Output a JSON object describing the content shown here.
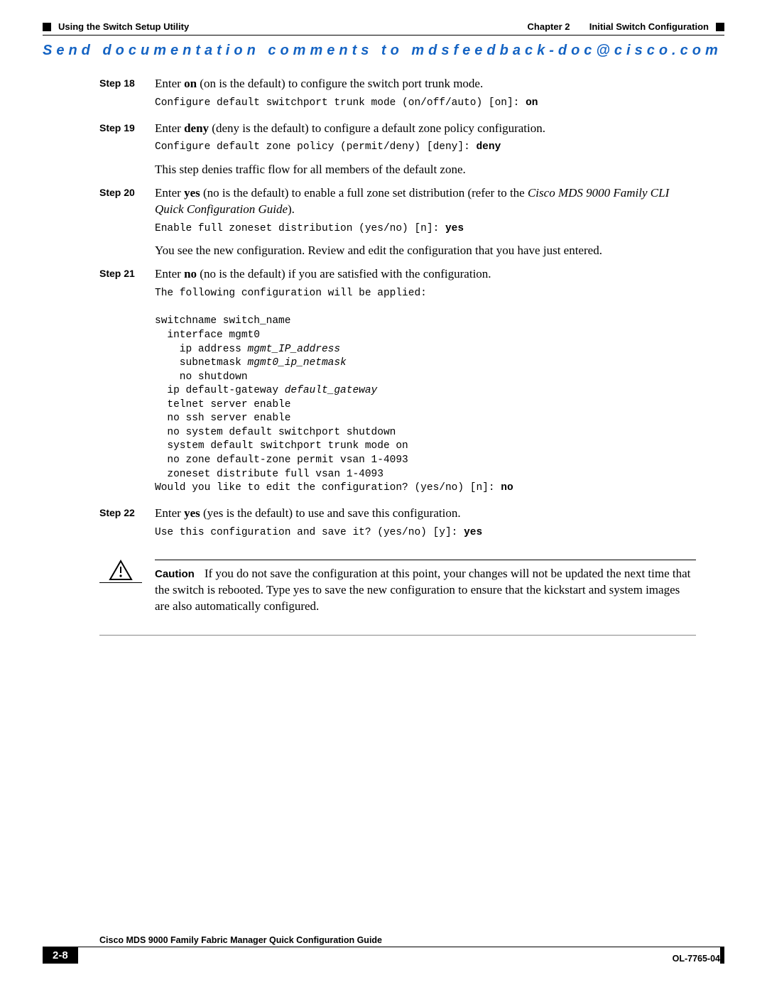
{
  "header": {
    "left": "Using the Switch Setup Utility",
    "chapter": "Chapter 2",
    "title": "Initial Switch Configuration"
  },
  "banner": "Send documentation comments to mdsfeedback-doc@cisco.com",
  "steps": {
    "s18": {
      "label": "Step 18",
      "text_pre": "Enter ",
      "text_bold": "on",
      "text_post": " (on is the default) to configure the switch port trunk mode.",
      "code": "Configure default switchport trunk mode (on/off/auto) [on]: ",
      "code_bold": "on"
    },
    "s19": {
      "label": "Step 19",
      "text_pre": "Enter ",
      "text_bold": "deny",
      "text_post": " (deny is the default) to configure a default zone policy configuration.",
      "code": "Configure default zone policy (permit/deny) [deny]: ",
      "code_bold": "deny",
      "after": "This step denies traffic flow for all members of the default zone."
    },
    "s20": {
      "label": "Step 20",
      "text_pre": "Enter ",
      "text_bold": "yes",
      "text_post1": " (no is the default) to enable a full zone set distribution (refer to the ",
      "text_ital": "Cisco MDS 9000 Family CLI Quick Configuration Guide",
      "text_post2": ").",
      "code": "Enable full zoneset distribution (yes/no) [n]: ",
      "code_bold": "yes",
      "after": "You see the new configuration. Review and edit the configuration that you have just entered."
    },
    "s21": {
      "label": "Step 21",
      "text_pre": "Enter ",
      "text_bold": "no",
      "text_post": " (no is the default) if you are satisfied with the configuration.",
      "code_lines": [
        {
          "t": "The following configuration will be applied:"
        },
        {
          "t": ""
        },
        {
          "t": "switchname switch_name"
        },
        {
          "t": "  interface mgmt0"
        },
        {
          "t": "    ip address ",
          "i": "mgmt_IP_address"
        },
        {
          "t": "    subnetmask ",
          "i": "mgmt0_ip_netmask"
        },
        {
          "t": "    no shutdown"
        },
        {
          "t": "  ip default-gateway ",
          "i": "default_gateway"
        },
        {
          "t": "  telnet server enable"
        },
        {
          "t": "  no ssh server enable"
        },
        {
          "t": "  no system default switchport shutdown"
        },
        {
          "t": "  system default switchport trunk mode on"
        },
        {
          "t": "  no zone default-zone permit vsan 1-4093"
        },
        {
          "t": "  zoneset distribute full vsan 1-4093"
        },
        {
          "t": "Would you like to edit the configuration? (yes/no) [n]: ",
          "b": "no"
        }
      ]
    },
    "s22": {
      "label": "Step 22",
      "text_pre": "Enter ",
      "text_bold": "yes",
      "text_post": " (yes is the default) to use and save this configuration.",
      "code": "Use this configuration and save it? (yes/no) [y]: ",
      "code_bold": "yes"
    }
  },
  "caution": {
    "label": "Caution",
    "text": "If you do not save the configuration at this point, your changes will not be updated the next time that the switch is rebooted. Type yes to save the new configuration to ensure that the kickstart and system images are also automatically configured."
  },
  "footer": {
    "title": "Cisco MDS 9000 Family Fabric Manager Quick Configuration Guide",
    "page": "2-8",
    "docnum": "OL-7765-04"
  }
}
